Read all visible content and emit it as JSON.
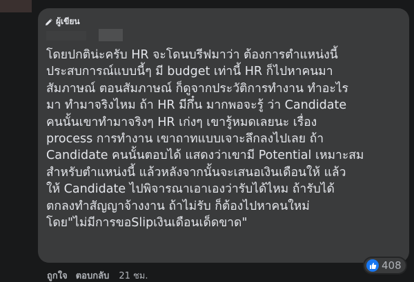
{
  "comment": {
    "author_badge": "ผู้เขียน",
    "text": "โดยปกติน่ะครับ HR จะโดนบรีฟมาว่า ต้องการตำแหน่งนี้\nประสบการณ์แบบนี้ๆ มี budget เท่านี้ HR ก็ไปหาคนมา\nสัมภาษณ์ ตอนสัมภาษณ์ ก็ดูจากประวัติการทำงาน ทำอะไร\nมา ทำมาจริงไหม ถ้า HR มีกึ๋น มากพอจะรู้ ว่า Candidate\nคนนั้นเขาทำมาจริงๆ HR เก่งๆ เขารู้หมดเลยนะ เรื่อง\nprocess การทำงาน เขาถาทแบบเจาะลึกลงไปเลย ถ้า\nCandidate คนนั้นตอบได้ แสดงว่าเขามี Potential เหมาะสม\nสำหรับตำแหน่งนี้ แล้วหลังจากนั้นจะเสนอเงินเดือนให้ แล้ว\nให้ Candidate ไปพิจารณาเอาเองว่ารับได้ไหม ถ้ารับได้\nตกลงทำสัญญาจ้างงาน ถ้าไม่รับ ก็ต้องไปหาคนใหม่\nโดย\"ไม่มีการขอSlipเงินเดือนเด็ดขาด\"",
    "reaction_count": "408",
    "reaction_icon": "like-icon",
    "like_label": "ถูกใจ",
    "reply_label": "ตอบกลับ",
    "timestamp": "21 ชม."
  },
  "colors": {
    "background": "#18191a",
    "bubble": "#3a3b3c",
    "text": "#e4e6eb",
    "secondary_text": "#b0b3b8",
    "like_blue": "#1877f2"
  }
}
